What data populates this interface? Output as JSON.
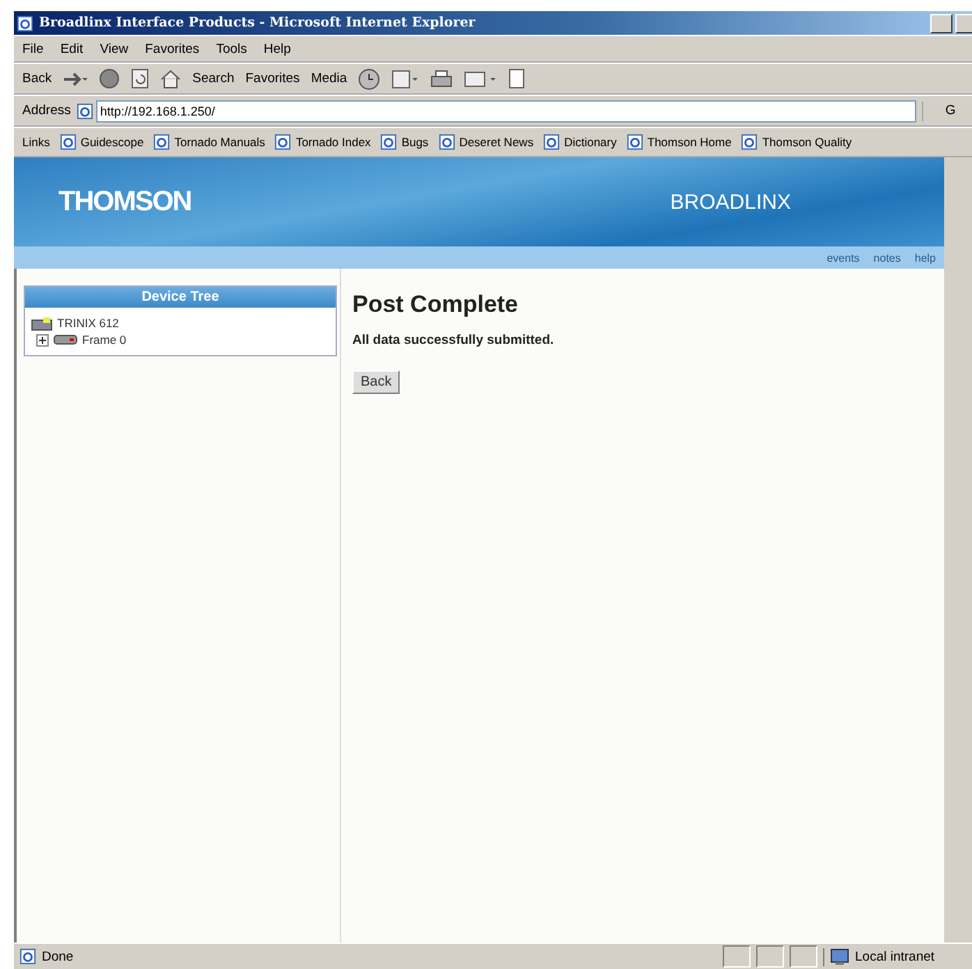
{
  "window": {
    "title": "Broadlinx Interface Products - Microsoft Internet Explorer"
  },
  "menu": [
    "File",
    "Edit",
    "View",
    "Favorites",
    "Tools",
    "Help"
  ],
  "toolbar": [
    {
      "kind": "text",
      "label": "Back"
    },
    {
      "kind": "icon"
    },
    {
      "kind": "icon"
    },
    {
      "kind": "icon"
    },
    {
      "kind": "icon"
    },
    {
      "kind": "text",
      "label": "Search"
    },
    {
      "kind": "text",
      "label": "Favorites"
    },
    {
      "kind": "text",
      "label": "Media"
    },
    {
      "kind": "icon"
    },
    {
      "kind": "icon"
    },
    {
      "kind": "icon"
    },
    {
      "kind": "icon"
    },
    {
      "kind": "icon"
    }
  ],
  "address": {
    "label": "Address",
    "value": "http://192.168.1.250/",
    "go": "G"
  },
  "links": {
    "label": "Links",
    "items": [
      "Guidescope",
      "Tornado Manuals",
      "Tornado Index",
      "Bugs",
      "Deseret News",
      "Dictionary",
      "Thomson Home",
      "Thomson Quality"
    ]
  },
  "banner": {
    "logo": "THOMSON",
    "brand": "BROADLINX",
    "nav": [
      "events",
      "notes",
      "help"
    ]
  },
  "sidebar": {
    "title": "Device Tree",
    "tree": [
      {
        "label": "TRINIX 612",
        "children": [
          {
            "label": "Frame 0",
            "expanded": false
          }
        ]
      }
    ]
  },
  "main": {
    "heading": "Post Complete",
    "message": "All data successfully submitted.",
    "button": "Back"
  },
  "status_bar": {
    "text": "Done",
    "zone": "Local intranet"
  }
}
